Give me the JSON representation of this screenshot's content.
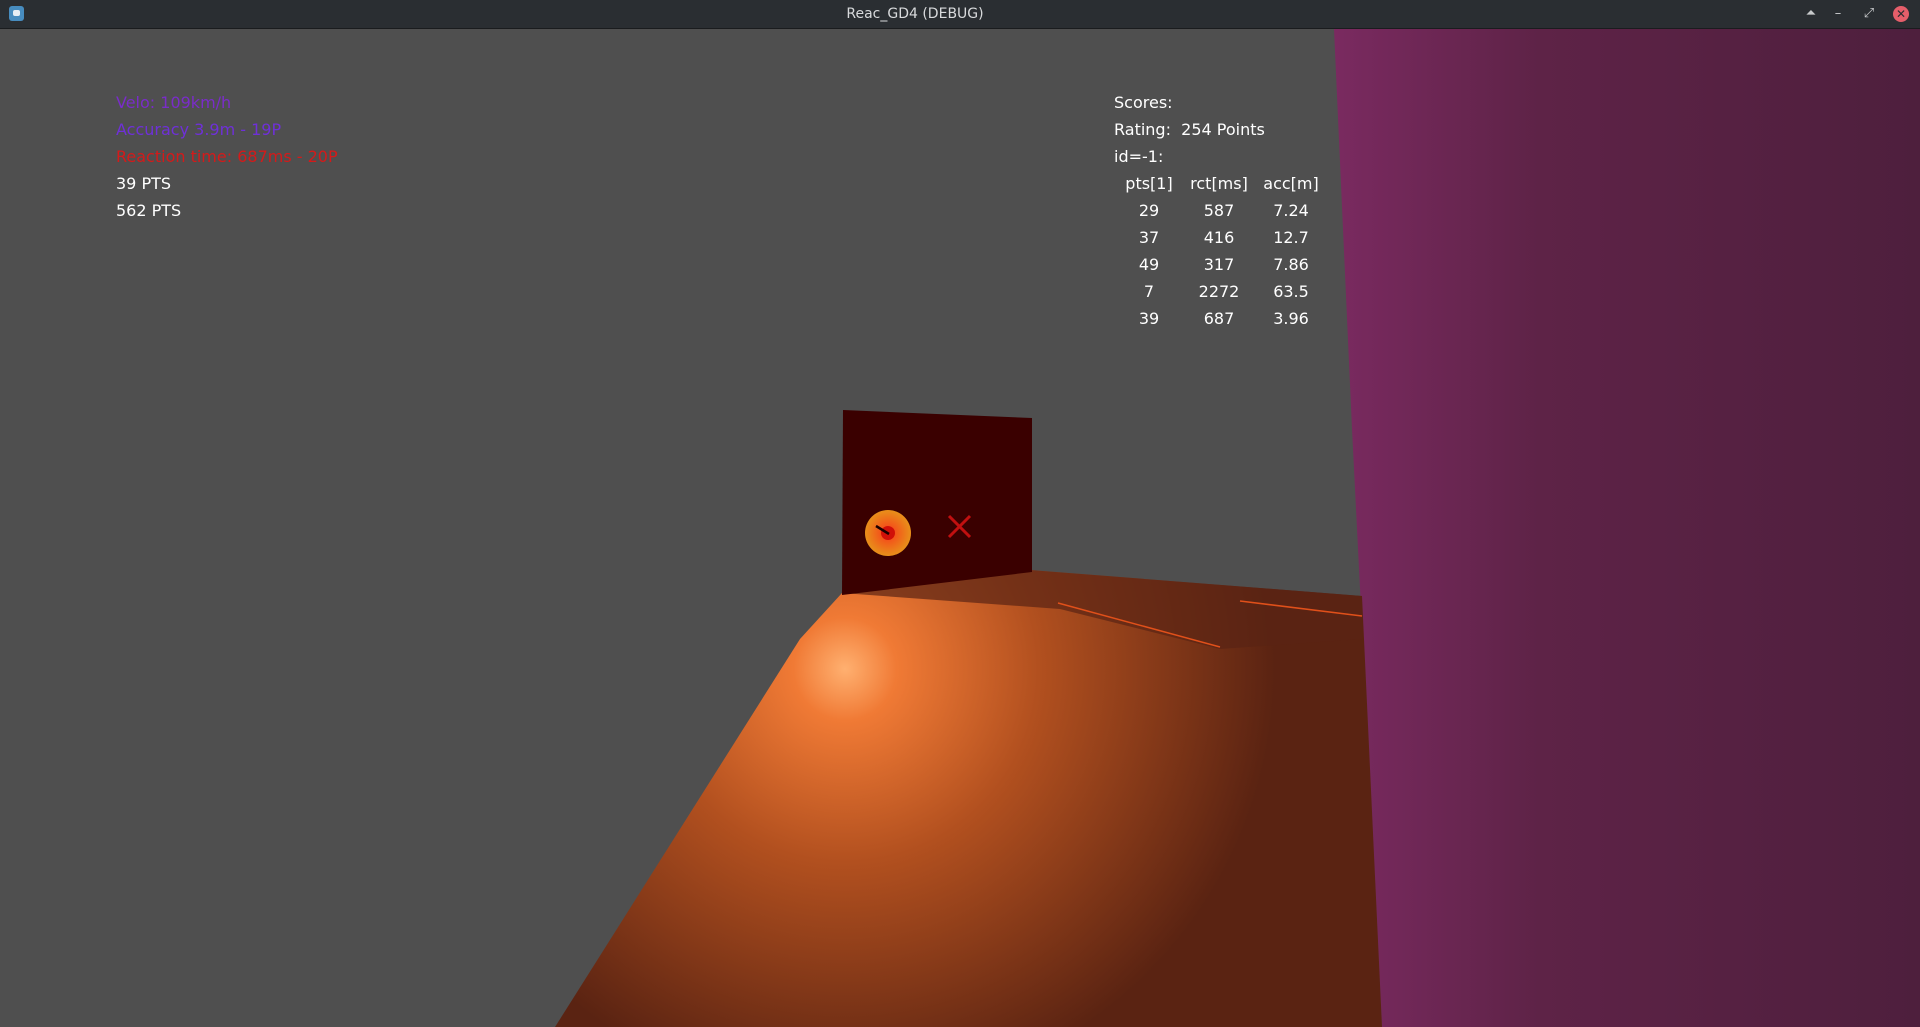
{
  "window": {
    "title": "Reac_GD4 (DEBUG)",
    "app_icon": "godot-icon",
    "controls": {
      "keep_above": "⏶",
      "minimize": "–",
      "maximize": "⤢",
      "close": "✕"
    }
  },
  "hud": {
    "velocity": "Velo: 109km/h",
    "accuracy": "Accuracy 3.9m - 19P",
    "reaction": "Reaction time: 687ms - 20P",
    "points_last": "39 PTS",
    "points_total": "562 PTS"
  },
  "scores": {
    "title": "Scores:",
    "rating_label": "Rating:",
    "rating_value": "254 Points",
    "id_label": "id=-1:",
    "columns": [
      "pts[1]",
      "rct[ms]",
      "acc[m]"
    ],
    "rows": [
      [
        "29",
        "587",
        "7.24"
      ],
      [
        "37",
        "416",
        "12.7"
      ],
      [
        "49",
        "317",
        "7.86"
      ],
      [
        "7",
        "2272",
        "63.5"
      ],
      [
        "39",
        "687",
        "3.96"
      ]
    ]
  },
  "colors": {
    "background": "#4f4f4f",
    "road": "#8a3a1a",
    "wall": "#5a2140",
    "target_board": "#3a0000",
    "target": "#f08a1a",
    "miss_marker": "#c01010",
    "hud_velo": "#7a2cc9",
    "hud_accuracy": "#6f30d8",
    "hud_reaction": "#d41a1a"
  }
}
